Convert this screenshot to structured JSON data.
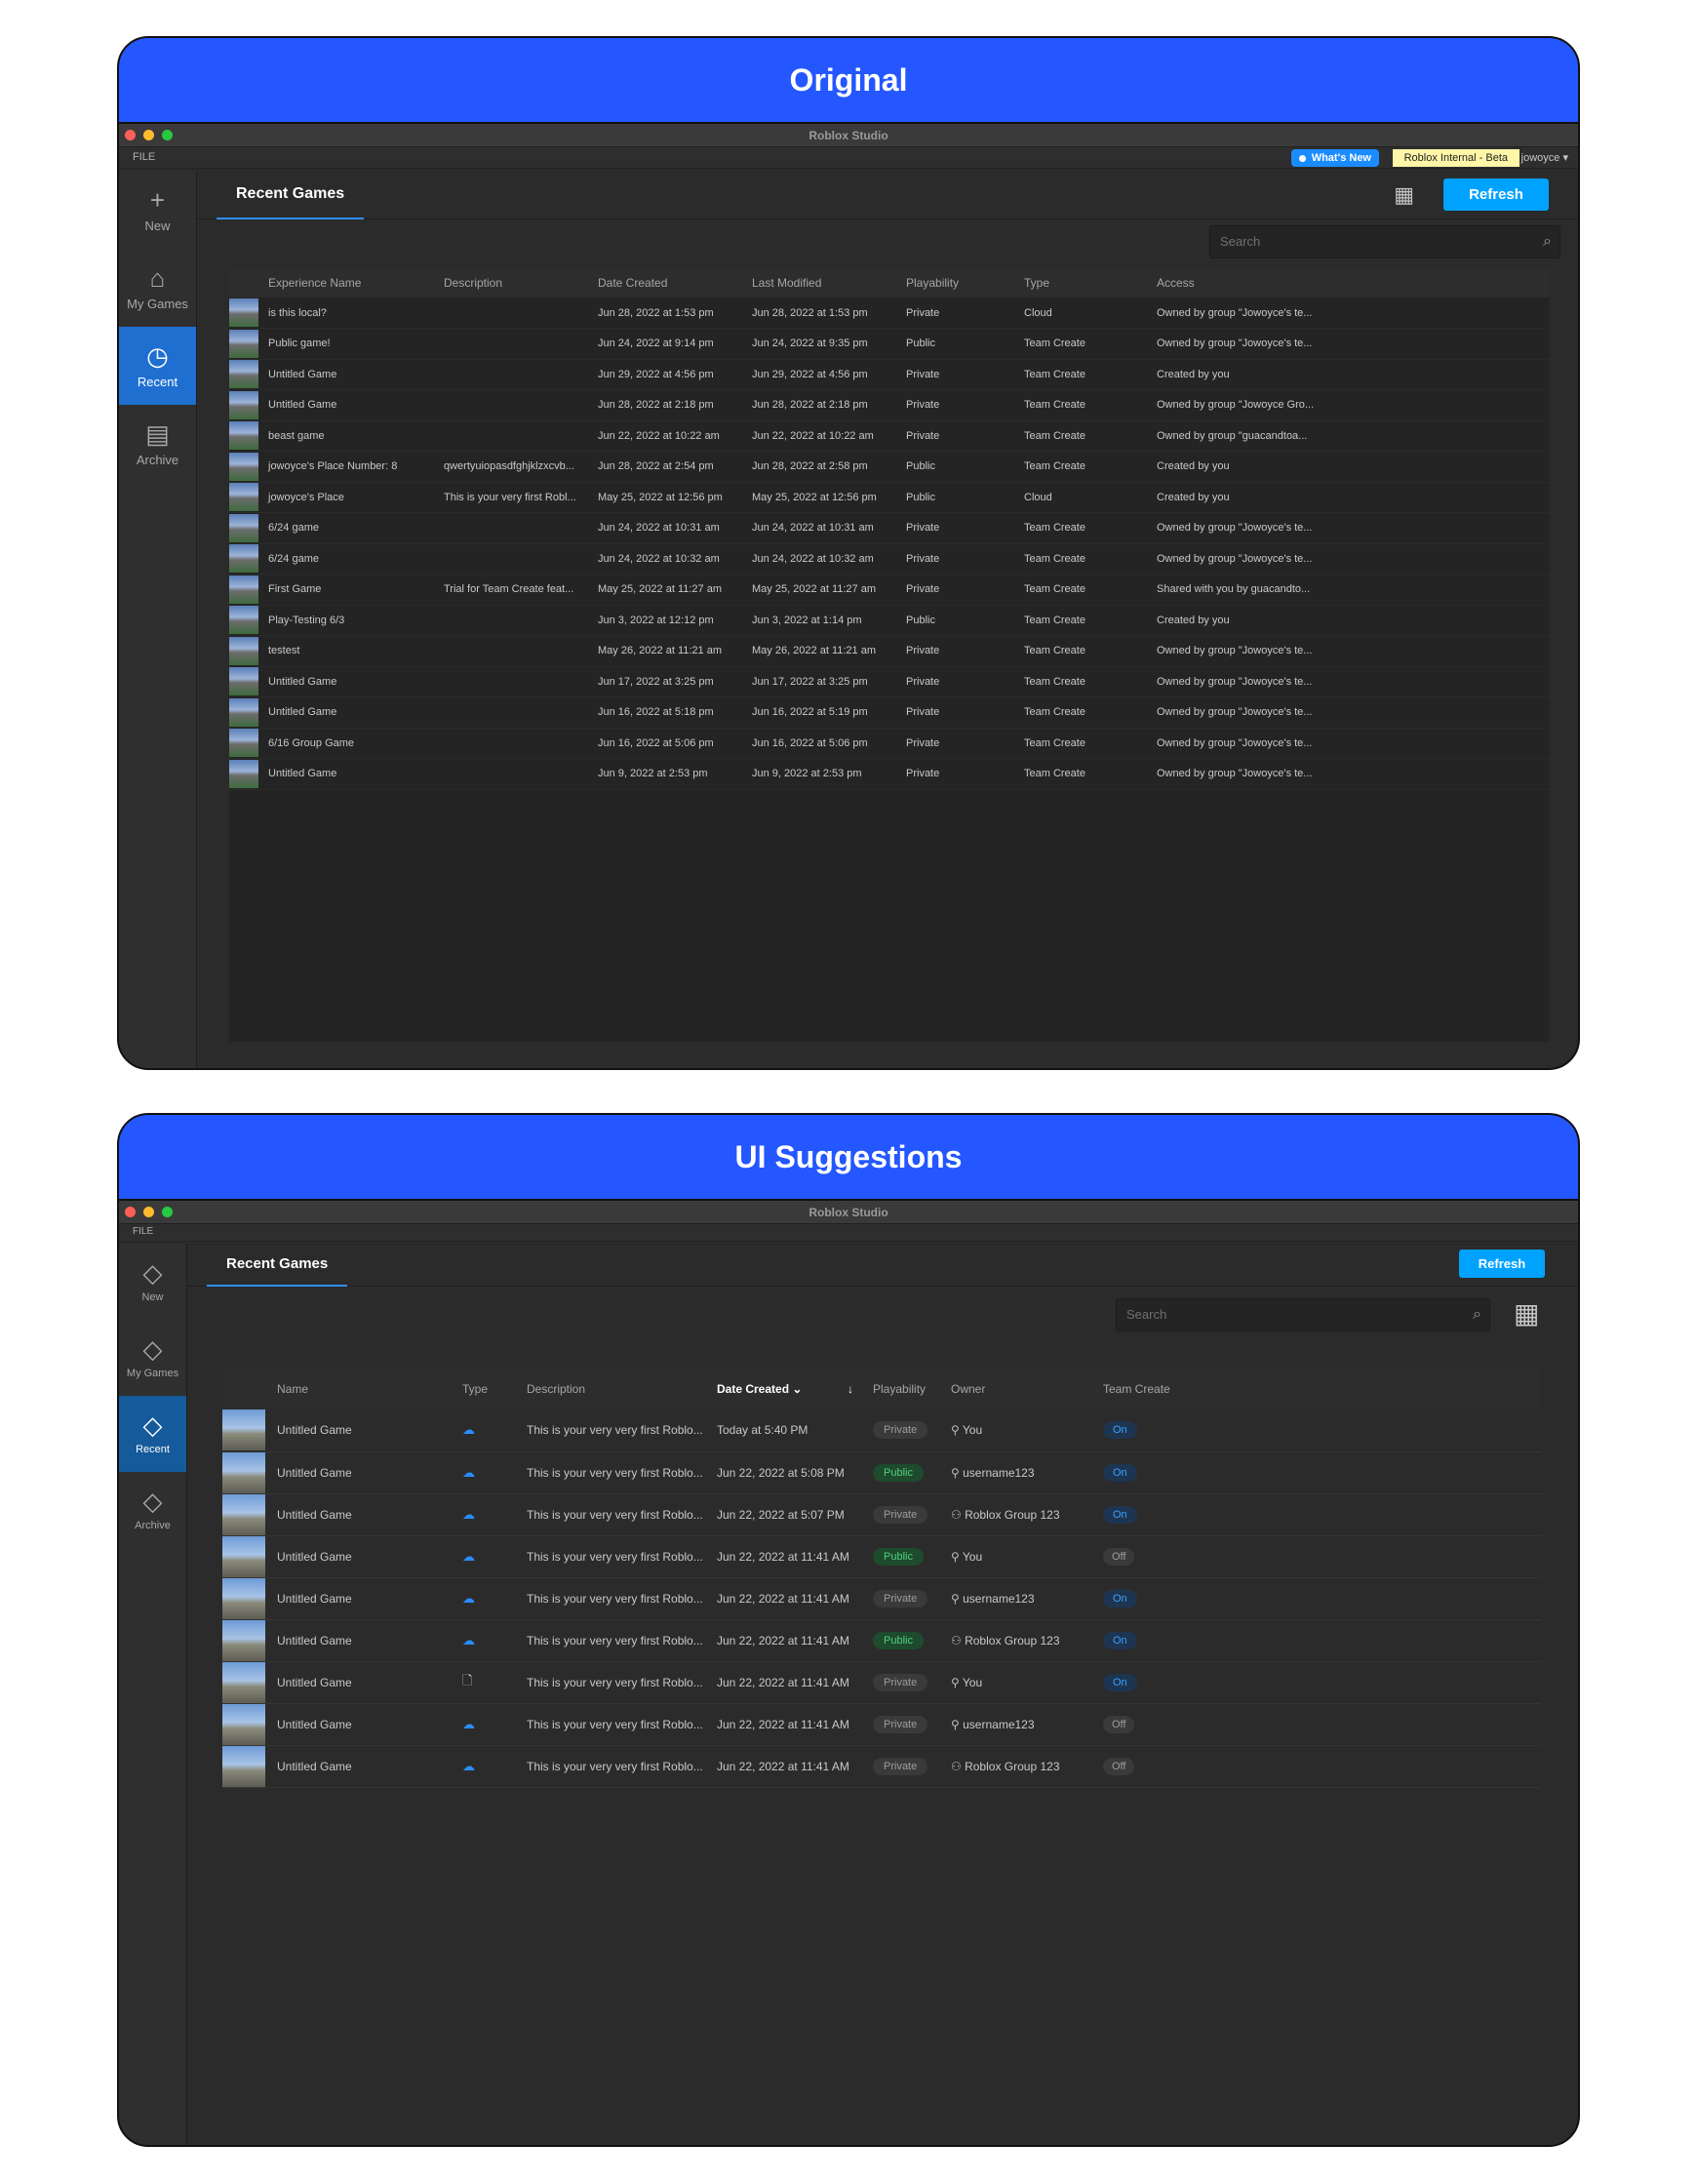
{
  "original": {
    "banner": "Original",
    "app_title": "Roblox Studio",
    "menu_file": "FILE",
    "whats_new": "What's New",
    "internal_badge": "Roblox Internal - Beta",
    "username": "jowoyce",
    "nav": [
      {
        "label": "New",
        "icon": "+"
      },
      {
        "label": "My Games",
        "icon": "⌂"
      },
      {
        "label": "Recent",
        "icon": "◷"
      },
      {
        "label": "Archive",
        "icon": "▤"
      }
    ],
    "tab": "Recent Games",
    "refresh": "Refresh",
    "search_placeholder": "Search",
    "columns": [
      "Experience Name",
      "Description",
      "Date Created",
      "Last Modified",
      "Playability",
      "Type",
      "Access"
    ],
    "rows": [
      [
        "is this local?",
        "",
        "Jun 28, 2022 at 1:53 pm",
        "Jun 28, 2022 at 1:53 pm",
        "Private",
        "Cloud",
        "Owned by group \"Jowoyce's te..."
      ],
      [
        "Public game!",
        "",
        "Jun 24, 2022 at 9:14 pm",
        "Jun 24, 2022 at 9:35 pm",
        "Public",
        "Team Create",
        "Owned by group \"Jowoyce's te..."
      ],
      [
        "Untitled Game",
        "",
        "Jun 29, 2022 at 4:56 pm",
        "Jun 29, 2022 at 4:56 pm",
        "Private",
        "Team Create",
        "Created by you"
      ],
      [
        "Untitled Game",
        "",
        "Jun 28, 2022 at 2:18 pm",
        "Jun 28, 2022 at 2:18 pm",
        "Private",
        "Team Create",
        "Owned by group \"Jowoyce Gro..."
      ],
      [
        "beast game",
        "",
        "Jun 22, 2022 at 10:22 am",
        "Jun 22, 2022 at 10:22 am",
        "Private",
        "Team Create",
        "Owned by group \"guacandtoa..."
      ],
      [
        "jowoyce's Place Number: 8",
        "qwertyuiopasdfghjklzxcvb...",
        "Jun 28, 2022 at 2:54 pm",
        "Jun 28, 2022 at 2:58 pm",
        "Public",
        "Team Create",
        "Created by you"
      ],
      [
        "jowoyce's Place",
        "This is your very first Robl...",
        "May 25, 2022 at 12:56 pm",
        "May 25, 2022 at 12:56 pm",
        "Public",
        "Cloud",
        "Created by you"
      ],
      [
        "6/24 game",
        "",
        "Jun 24, 2022 at 10:31 am",
        "Jun 24, 2022 at 10:31 am",
        "Private",
        "Team Create",
        "Owned by group \"Jowoyce's te..."
      ],
      [
        "6/24 game",
        "",
        "Jun 24, 2022 at 10:32 am",
        "Jun 24, 2022 at 10:32 am",
        "Private",
        "Team Create",
        "Owned by group \"Jowoyce's te..."
      ],
      [
        "First Game",
        "Trial for Team Create feat...",
        "May 25, 2022 at 11:27 am",
        "May 25, 2022 at 11:27 am",
        "Private",
        "Team Create",
        "Shared with you by guacandto..."
      ],
      [
        "Play-Testing 6/3",
        "",
        "Jun 3, 2022 at 12:12 pm",
        "Jun 3, 2022 at 1:14 pm",
        "Public",
        "Team Create",
        "Created by you"
      ],
      [
        "testest",
        "",
        "May 26, 2022 at 11:21 am",
        "May 26, 2022 at 11:21 am",
        "Private",
        "Team Create",
        "Owned by group \"Jowoyce's te..."
      ],
      [
        "Untitled Game",
        "",
        "Jun 17, 2022 at 3:25 pm",
        "Jun 17, 2022 at 3:25 pm",
        "Private",
        "Team Create",
        "Owned by group \"Jowoyce's te..."
      ],
      [
        "Untitled Game",
        "",
        "Jun 16, 2022 at 5:18 pm",
        "Jun 16, 2022 at 5:19 pm",
        "Private",
        "Team Create",
        "Owned by group \"Jowoyce's te..."
      ],
      [
        "6/16 Group Game",
        "",
        "Jun 16, 2022 at 5:06 pm",
        "Jun 16, 2022 at 5:06 pm",
        "Private",
        "Team Create",
        "Owned by group \"Jowoyce's te..."
      ],
      [
        "Untitled Game",
        "",
        "Jun 9, 2022 at 2:53 pm",
        "Jun 9, 2022 at 2:53 pm",
        "Private",
        "Team Create",
        "Owned by group \"Jowoyce's te..."
      ]
    ]
  },
  "suggestion": {
    "banner": "UI Suggestions",
    "app_title": "Roblox Studio",
    "menu_file": "FILE",
    "nav": [
      {
        "label": "New",
        "icon": "◇"
      },
      {
        "label": "My Games",
        "icon": "◇"
      },
      {
        "label": "Recent",
        "icon": "◇"
      },
      {
        "label": "Archive",
        "icon": "◇"
      }
    ],
    "tab": "Recent Games",
    "refresh": "Refresh",
    "search_placeholder": "Search",
    "columns": [
      "Name",
      "Type",
      "Description",
      "Date Created",
      "Playability",
      "Owner",
      "Team Create"
    ],
    "rows": [
      {
        "name": "Untitled Game",
        "type": "cloud",
        "description": "This is your very very first Roblo...",
        "date": "Today at 5:40 PM",
        "playability": "Private",
        "owner": "You",
        "owner_type": "user",
        "team_create": "On"
      },
      {
        "name": "Untitled Game",
        "type": "cloud",
        "description": "This is your very very first Roblo...",
        "date": "Jun 22, 2022 at 5:08 PM",
        "playability": "Public",
        "owner": "username123",
        "owner_type": "user",
        "team_create": "On"
      },
      {
        "name": "Untitled Game",
        "type": "cloud",
        "description": "This is your very very first Roblo...",
        "date": "Jun 22, 2022 at 5:07 PM",
        "playability": "Private",
        "owner": "Roblox Group 123",
        "owner_type": "group",
        "team_create": "On"
      },
      {
        "name": "Untitled Game",
        "type": "cloud",
        "description": "This is your very very first Roblo...",
        "date": "Jun 22, 2022 at 11:41 AM",
        "playability": "Public",
        "owner": "You",
        "owner_type": "user",
        "team_create": "Off"
      },
      {
        "name": "Untitled Game",
        "type": "cloud",
        "description": "This is your very very first Roblo...",
        "date": "Jun 22, 2022 at 11:41 AM",
        "playability": "Private",
        "owner": "username123",
        "owner_type": "user",
        "team_create": "On"
      },
      {
        "name": "Untitled Game",
        "type": "cloud",
        "description": "This is your very very first Roblo...",
        "date": "Jun 22, 2022 at 11:41 AM",
        "playability": "Public",
        "owner": "Roblox Group 123",
        "owner_type": "group",
        "team_create": "On"
      },
      {
        "name": "Untitled Game",
        "type": "file",
        "description": "This is your very very first Roblo...",
        "date": "Jun 22, 2022 at 11:41 AM",
        "playability": "Private",
        "owner": "You",
        "owner_type": "user",
        "team_create": "On"
      },
      {
        "name": "Untitled Game",
        "type": "cloud",
        "description": "This is your very very first Roblo...",
        "date": "Jun 22, 2022 at 11:41 AM",
        "playability": "Private",
        "owner": "username123",
        "owner_type": "user",
        "team_create": "Off"
      },
      {
        "name": "Untitled Game",
        "type": "cloud",
        "description": "This is your very very first Roblo...",
        "date": "Jun 22, 2022 at 11:41 AM",
        "playability": "Private",
        "owner": "Roblox Group 123",
        "owner_type": "group",
        "team_create": "Off"
      }
    ]
  },
  "colors": {
    "banner": "#2457ff",
    "accent": "#00a2ff",
    "active_nav": "#1f6fd1"
  }
}
